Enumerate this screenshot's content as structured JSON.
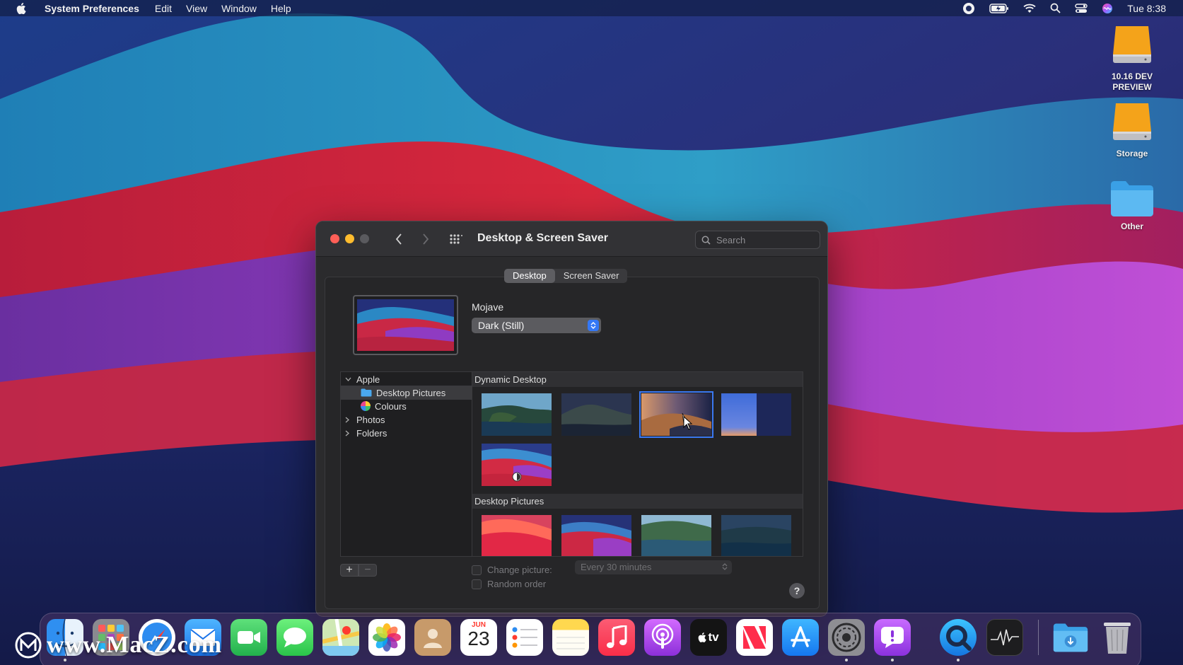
{
  "menubar": {
    "app_name": "System Preferences",
    "menus": [
      "Edit",
      "View",
      "Window",
      "Help"
    ],
    "clock": "Tue 8:38"
  },
  "desktop_icons": [
    {
      "label": "10.16 DEV PREVIEW",
      "kind": "external-drive"
    },
    {
      "label": "Storage",
      "kind": "external-drive"
    },
    {
      "label": "Other",
      "kind": "folder"
    }
  ],
  "window": {
    "title": "Desktop & Screen Saver",
    "search": {
      "placeholder": "Search",
      "value": ""
    },
    "tabs": [
      {
        "label": "Desktop",
        "active": true
      },
      {
        "label": "Screen Saver",
        "active": false
      }
    ],
    "current_wallpaper": "Mojave",
    "appearance_mode": "Dark (Still)",
    "sources": {
      "apple_group": "Apple",
      "apple_children": [
        "Desktop Pictures",
        "Colours"
      ],
      "selected": "Desktop Pictures",
      "others": [
        "Photos",
        "Folders"
      ]
    },
    "sections": {
      "dynamic": "Dynamic Desktop",
      "pictures": "Desktop Pictures"
    },
    "change_picture_label": "Change picture:",
    "interval_value": "Every 30 minutes",
    "random_order_label": "Random order",
    "help_label": "?"
  },
  "colors": {
    "accent": "#3478f6",
    "close": "#ff5f57",
    "minimize": "#febc2e"
  },
  "dock": [
    "finder-icon",
    "launchpad-icon",
    "safari-icon",
    "mail-icon",
    "facetime-icon",
    "messages-icon",
    "maps-icon",
    "photos-icon",
    "contacts-icon",
    "calendar-icon",
    "reminders-icon",
    "notes-icon",
    "music-icon",
    "podcasts-icon",
    "apple-tv-icon",
    "news-icon",
    "app-store-icon",
    "system-preferences-icon",
    "feedback-assistant-icon",
    "quicktime-icon",
    "activity-monitor-icon",
    "downloads-folder-icon",
    "trash-icon"
  ],
  "calendar": {
    "month": "JUN",
    "day": "23"
  },
  "tv_label": "tv",
  "watermark": "www.MacZ.com"
}
